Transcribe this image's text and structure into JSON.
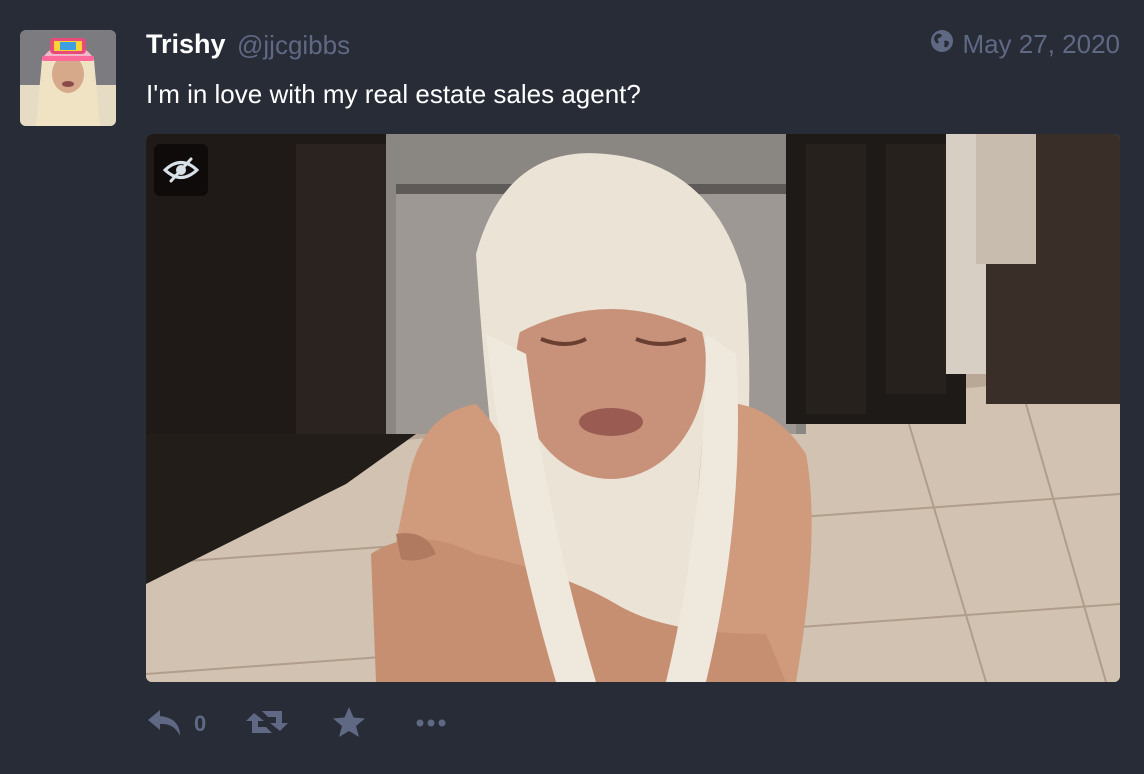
{
  "status": {
    "author": {
      "display_name": "Trishy",
      "handle": "@jjcgibbs"
    },
    "visibility_icon": "globe-icon",
    "date": "May 27, 2020",
    "content": "I'm in love with my real estate sales agent?",
    "media": {
      "hide_icon": "eye-slash-icon"
    },
    "actions": {
      "reply_icon": "reply-icon",
      "reply_count": "0",
      "boost_icon": "retweet-icon",
      "favourite_icon": "star-icon",
      "more_icon": "ellipsis-icon"
    }
  },
  "colors": {
    "background": "#282c37",
    "muted": "#606984",
    "text": "#ffffff"
  }
}
